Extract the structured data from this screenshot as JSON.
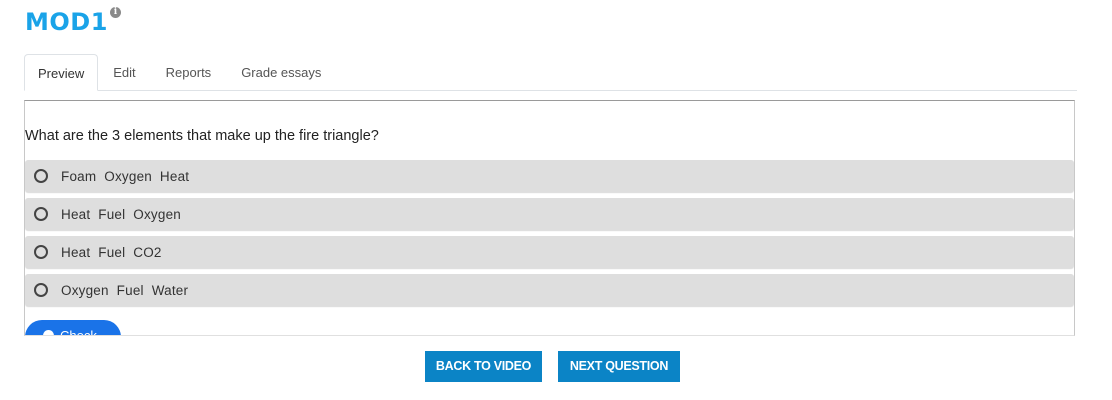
{
  "header": {
    "title": "MOD1",
    "info_icon": "info-icon"
  },
  "tabs": [
    {
      "label": "Preview",
      "active": true
    },
    {
      "label": "Edit",
      "active": false
    },
    {
      "label": "Reports",
      "active": false
    },
    {
      "label": "Grade essays",
      "active": false
    }
  ],
  "quiz": {
    "question": "What are the 3 elements that make up the fire triangle?",
    "options": [
      {
        "label": "Foam Oxygen Heat"
      },
      {
        "label": "Heat Fuel Oxygen"
      },
      {
        "label": "Heat Fuel CO2"
      },
      {
        "label": "Oxygen Fuel Water"
      }
    ],
    "check_label": "Check"
  },
  "nav": {
    "back_label": "BACK TO VIDEO",
    "next_label": "NEXT QUESTION"
  },
  "colors": {
    "title": "#1aa3e8",
    "nav_button": "#0b84c6",
    "check_button": "#1a73e8",
    "option_bg": "#dedede"
  }
}
